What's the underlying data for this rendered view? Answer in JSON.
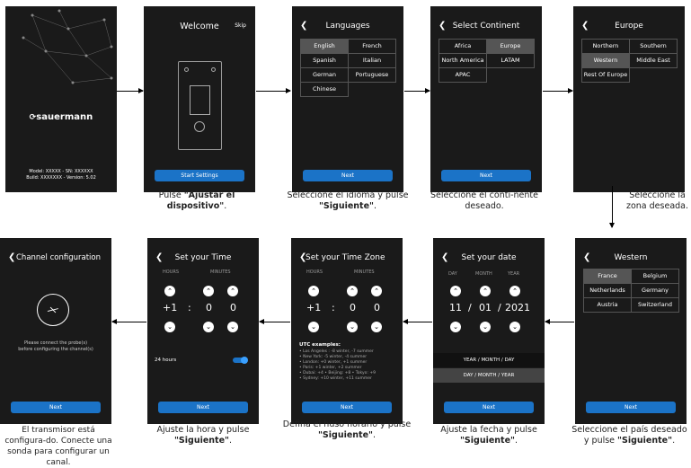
{
  "phone1": {
    "logo": "sauermann",
    "model": "Model: XXXXX - SN: XXXXXX",
    "build": "Build: XXXXXXX - Version: 5.02"
  },
  "phone2": {
    "title": "Welcome",
    "skip": "Skip",
    "button": "Start Settings"
  },
  "phone3": {
    "title": "Languages",
    "options": [
      "English",
      "French",
      "Spanish",
      "Italian",
      "German",
      "Portuguese",
      "Chinese"
    ],
    "selected": "English",
    "button": "Next"
  },
  "phone4": {
    "title": "Select Continent",
    "options": [
      "Africa",
      "Europe",
      "North America",
      "LATAM",
      "APAC"
    ],
    "selected": "Europe",
    "button": "Next"
  },
  "phone5": {
    "title": "Europe",
    "options": [
      "Northern",
      "Southern",
      "Western",
      "Middle East",
      "Rest Of Europe"
    ],
    "selected": "Western"
  },
  "phone6": {
    "title": "Western",
    "options": [
      "France",
      "Belgium",
      "Netherlands",
      "Germany",
      "Austria",
      "Switzerland"
    ],
    "selected": "France",
    "button": "Next"
  },
  "phone7": {
    "title": "Set your date",
    "labels": [
      "DAY",
      "MONTH",
      "YEAR"
    ],
    "day": "11",
    "sep1": "/",
    "month": "01",
    "sep2": "/",
    "year": "2021",
    "format1": "YEAR / MONTH / DAY",
    "format2": "DAY / MONTH / YEAR",
    "button": "Next"
  },
  "phone8": {
    "title": "Set your Time Zone",
    "labels": [
      "HOURS",
      "MINUTES"
    ],
    "hours": "+1",
    "colon": ":",
    "min1": "0",
    "min2": "0",
    "utc_title": "UTC examples:",
    "utc": [
      "• Los Angeles : -8 winter, -7 summer",
      "• New York: -5 winter, -4 summer",
      "• London: +0 winter, +1 summer",
      "• Paris: +1 winter, +2 summer",
      "• Dubai: +4  • Beijing: +8  • Tokyo: +9",
      "• Sydney: +10 winter, +11 summer"
    ],
    "button": "Next"
  },
  "phone9": {
    "title": "Set your Time",
    "labels": [
      "HOURS",
      "MINUTES"
    ],
    "hours": "+1",
    "colon": ":",
    "min1": "0",
    "min2": "0",
    "toggle_label": "24 hours",
    "button": "Next"
  },
  "phone10": {
    "title": "Channel configuration",
    "message1": "Please connect the probe(s)",
    "message2": "before configuring the channel(s)",
    "button": "Next"
  },
  "captions": {
    "c2a": "Pulse ",
    "c2b": "\"Ajustar el dispositivo\"",
    "c2c": ".",
    "c3a": "Seleccione el idioma y pulse ",
    "c3b": "\"Siguiente\"",
    "c3c": ".",
    "c4": "Seleccione el conti-nente deseado.",
    "c5": "Seleccione la zona deseada.",
    "c6a": "Seleccione el país deseado y pulse ",
    "c6b": "\"Siguiente\"",
    "c6c": ".",
    "c7a": "Ajuste la fecha y pulse ",
    "c7b": "\"Siguiente\"",
    "c7c": ".",
    "c8a": "Defina el huso horario y pulse ",
    "c8b": "\"Siguiente\"",
    "c8c": ".",
    "c9a": "Ajuste la hora y pulse ",
    "c9b": "\"Siguiente\"",
    "c9c": ".",
    "c10": "El transmisor está configura-do. Conecte una sonda para configurar un canal."
  }
}
